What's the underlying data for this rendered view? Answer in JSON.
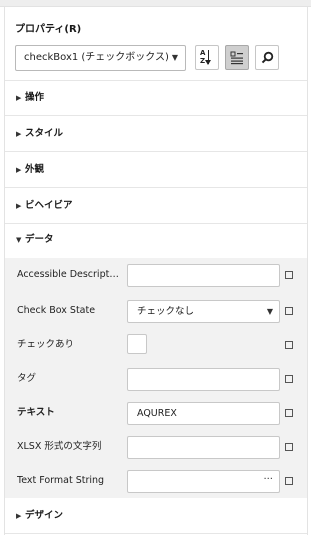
{
  "panel": {
    "title": "プロパティ(R)",
    "object_selector": "checkBox1 (チェックボックス)"
  },
  "toolbar": [
    {
      "name": "sort-alphabetical",
      "icon": "sort-az-icon"
    },
    {
      "name": "categorized",
      "icon": "categorized-grid-icon",
      "active": true
    },
    {
      "name": "search",
      "icon": "search-icon"
    }
  ],
  "sections": [
    {
      "label": "操作",
      "expanded": false
    },
    {
      "label": "スタイル",
      "expanded": false
    },
    {
      "label": "外観",
      "expanded": false
    },
    {
      "label": "ビヘイビア",
      "expanded": false
    },
    {
      "label": "データ",
      "expanded": true
    },
    {
      "label": "デザイン",
      "expanded": false
    }
  ],
  "properties": [
    {
      "label": "Accessible Description",
      "value": "",
      "type": "text"
    },
    {
      "label": "Check Box State",
      "value": "チェックなし",
      "type": "dropdown"
    },
    {
      "label": "チェックあり",
      "value": false,
      "type": "checkbox"
    },
    {
      "label": "タグ",
      "value": "",
      "type": "text"
    },
    {
      "label": "テキスト",
      "value": "AQUREX",
      "type": "text",
      "bold": true
    },
    {
      "label": "XLSX 形式の文字列",
      "value": "",
      "type": "text"
    },
    {
      "label": "Text Format String",
      "value": "",
      "type": "ellipsis",
      "button": "···"
    }
  ],
  "colors": {
    "grid_background": "#f2f2f2",
    "active_button": "#cfcfcf",
    "border": "#c8c8c8"
  }
}
